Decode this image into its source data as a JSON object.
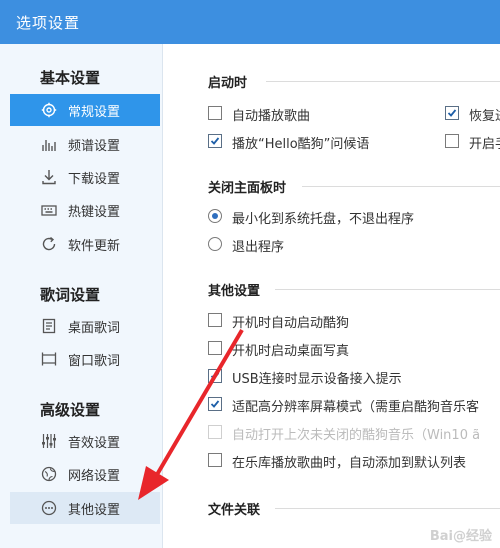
{
  "window": {
    "title": "选项设置"
  },
  "sidebar": {
    "groups": [
      {
        "title": "基本设置",
        "items": [
          {
            "label": "常规设置",
            "icon": "gear-icon"
          },
          {
            "label": "频谱设置",
            "icon": "spectrum-icon"
          },
          {
            "label": "下载设置",
            "icon": "download-icon"
          },
          {
            "label": "热键设置",
            "icon": "keyboard-icon"
          },
          {
            "label": "软件更新",
            "icon": "refresh-icon"
          }
        ]
      },
      {
        "title": "歌词设置",
        "items": [
          {
            "label": "桌面歌词",
            "icon": "desktop-lyrics-icon"
          },
          {
            "label": "窗口歌词",
            "icon": "window-lyrics-icon"
          }
        ]
      },
      {
        "title": "高级设置",
        "items": [
          {
            "label": "音效设置",
            "icon": "equalizer-icon"
          },
          {
            "label": "网络设置",
            "icon": "network-icon"
          },
          {
            "label": "其他设置",
            "icon": "more-icon"
          }
        ]
      }
    ],
    "active_item": "常规设置",
    "hover_item": "其他设置"
  },
  "main": {
    "startup": {
      "title": "启动时",
      "options": [
        {
          "label": "自动播放歌曲",
          "checked": false
        },
        {
          "label": "恢复进",
          "checked": true
        },
        {
          "label": "播放“Hello酷狗”问候语",
          "checked": true
        },
        {
          "label": "开启手",
          "checked": false
        }
      ]
    },
    "close_panel": {
      "title": "关闭主面板时",
      "options": [
        {
          "label": "最小化到系统托盘，不退出程序",
          "selected": true
        },
        {
          "label": "退出程序",
          "selected": false
        }
      ]
    },
    "other": {
      "title": "其他设置",
      "options": [
        {
          "label": "开机时自动启动酷狗",
          "checked": false,
          "disabled": false
        },
        {
          "label": "开机时启动桌面写真",
          "checked": false,
          "disabled": false
        },
        {
          "label": "USB连接时显示设备接入提示",
          "checked": true,
          "disabled": false
        },
        {
          "label": "适配高分辨率屏幕模式（需重启酷狗音乐客",
          "checked": true,
          "disabled": false
        },
        {
          "label": "自动打开上次未关闭的酷狗音乐（Win10 ã",
          "checked": false,
          "disabled": true
        },
        {
          "label": "在乐库播放歌曲时，自动添加到默认列表",
          "checked": false,
          "disabled": false
        }
      ]
    },
    "file_assoc": {
      "title": "文件关联"
    }
  },
  "colors": {
    "titlebar": "#3d8fe0",
    "active": "#2f95ea",
    "sidebar_bg": "#f1f7fd",
    "arrow": "#e8262b"
  }
}
